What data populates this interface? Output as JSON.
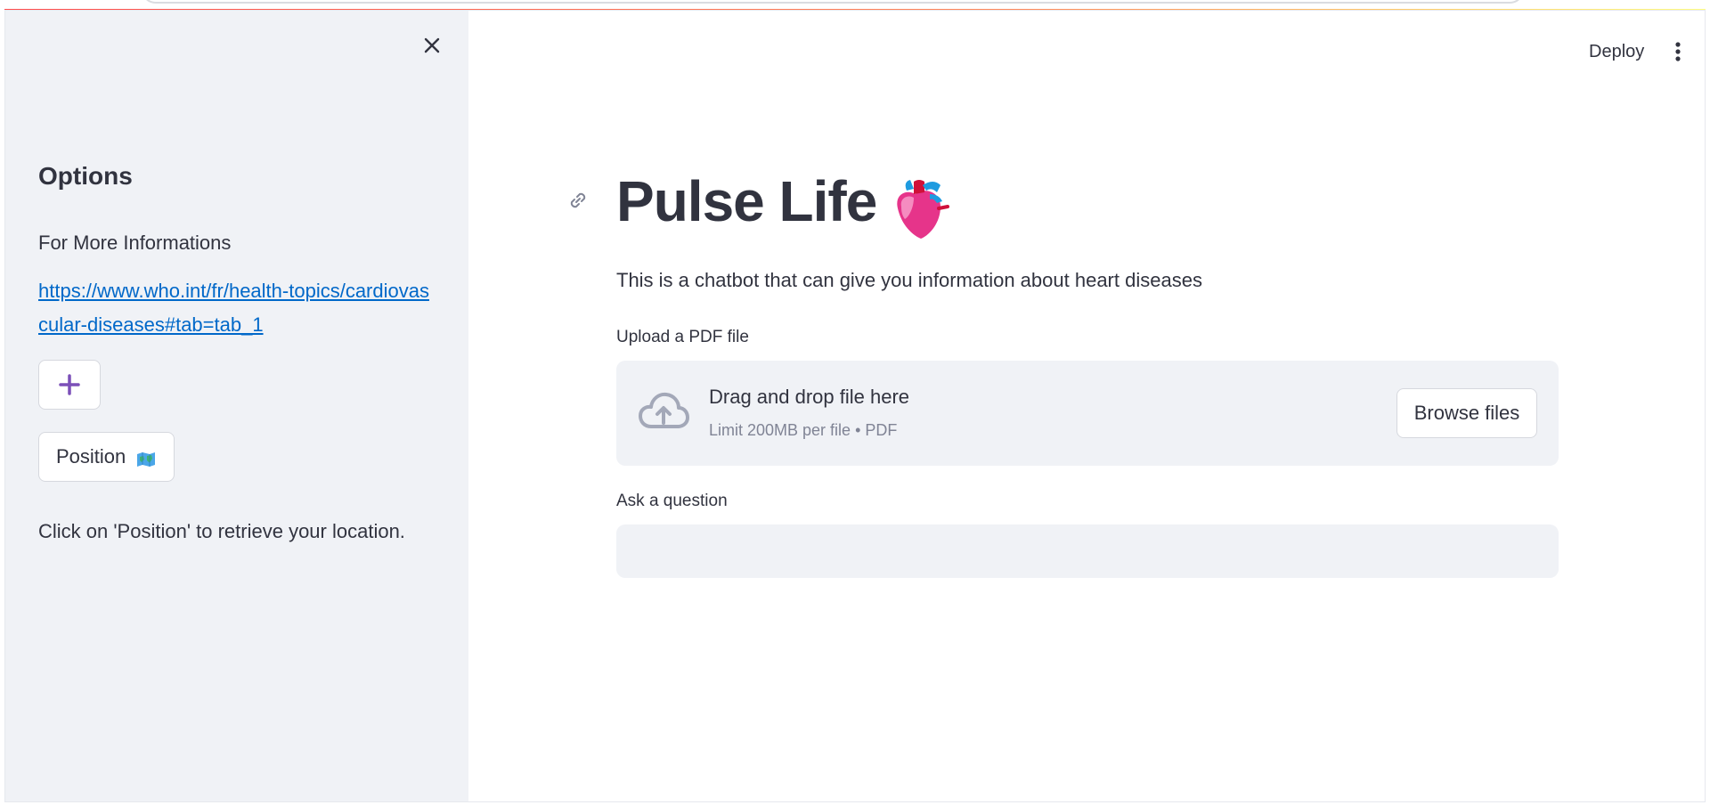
{
  "sidebar": {
    "title": "Options",
    "info_text": "For More Informations",
    "link_text": "https://www.who.int/fr/health-topics/cardiovascular-diseases#tab=tab_1",
    "add_button_icon": "plus-icon",
    "position_button_label": "Position",
    "position_button_icon": "world-map-icon",
    "hint_text": "Click on 'Position' to retrieve your location."
  },
  "header": {
    "deploy_label": "Deploy",
    "menu_icon": "vertical-dots-icon"
  },
  "main": {
    "title": "Pulse Life",
    "title_icon": "anatomical-heart-icon",
    "intro": "This is a chatbot that can give you information about heart diseases",
    "uploader": {
      "label": "Upload a PDF file",
      "drop_title": "Drag and drop file here",
      "limit_text": "Limit 200MB per file • PDF",
      "browse_label": "Browse files"
    },
    "question": {
      "label": "Ask a question",
      "value": ""
    }
  },
  "colors": {
    "accent_purple": "#7b4fb8",
    "link_blue": "#0068c9",
    "sidebar_bg": "#f0f2f6",
    "text": "#31333F"
  }
}
